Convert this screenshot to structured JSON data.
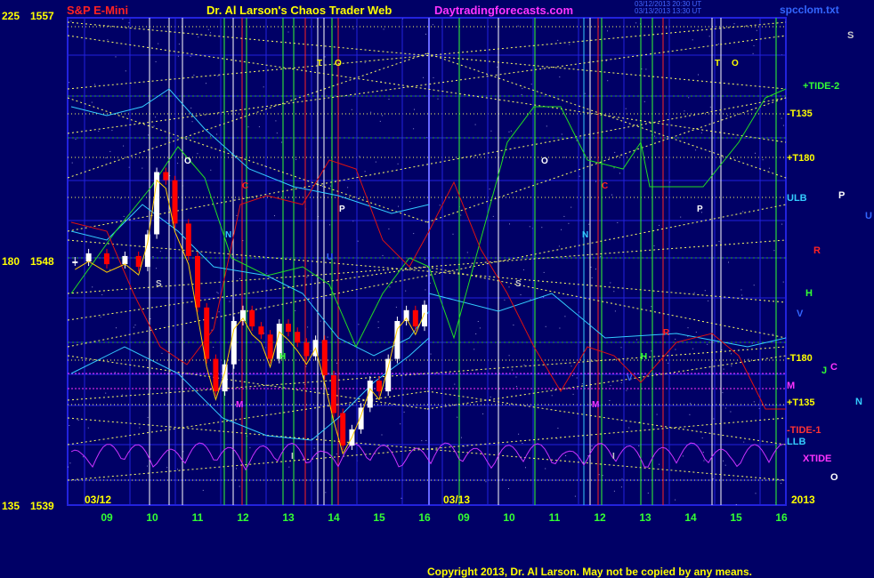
{
  "header": {
    "instrument": "S&P E-Mini",
    "title": "Dr. Al Larson's Chaos Trader Web",
    "site": "Daytradingforecasts.com",
    "file": "spcclom.txt",
    "stamp_line1": "03/12/2013 20:30 UT",
    "stamp_line2": "03/13/2013 13:30 UT"
  },
  "copyright": "Copyright 2013, Dr. Al Larson. May not be copied by any means.",
  "colors": {
    "background": "#000066",
    "price_up": "#ffffff",
    "price_down": "#ff0000",
    "grid": "#2222dd",
    "yellow_lines": "#ffff66",
    "green": "#22dd22",
    "red": "#dd1111",
    "cyan": "#33ccff",
    "magenta": "#cc33ff"
  },
  "chart_data": {
    "type": "line",
    "title": "S&P E-Mini",
    "y_axis": {
      "labels": [
        {
          "left": "225",
          "right": "1557"
        },
        {
          "left": "180",
          "right": "1548"
        },
        {
          "left": "135",
          "right": "1539"
        }
      ],
      "range": [
        1539,
        1557
      ]
    },
    "x_axis": {
      "sessions": [
        "03/12",
        "03/13"
      ],
      "year": "2013",
      "hours": [
        "09",
        "10",
        "11",
        "12",
        "13",
        "14",
        "15",
        "16",
        "09",
        "10",
        "11",
        "12",
        "13",
        "14",
        "15",
        "16"
      ]
    },
    "right_labels": [
      {
        "text": "+TIDE-2",
        "color": "#33ff33"
      },
      {
        "text": "-T135",
        "color": "#ffff00"
      },
      {
        "text": "+T180",
        "color": "#ffff00"
      },
      {
        "text": "ULB",
        "color": "#33ccff"
      },
      {
        "text": "-T180",
        "color": "#ffff00"
      },
      {
        "text": "M",
        "color": "#ff33ff"
      },
      {
        "text": "+T135",
        "color": "#ffff00"
      },
      {
        "text": "-TIDE-1",
        "color": "#ff3333"
      },
      {
        "text": "LLB",
        "color": "#33ccff"
      },
      {
        "text": "XTIDE",
        "color": "#ff33ff"
      }
    ],
    "planet_letters": [
      {
        "text": "S",
        "color": "#cccccc"
      },
      {
        "text": "P",
        "color": "#ffffff"
      },
      {
        "text": "U",
        "color": "#3366ff"
      },
      {
        "text": "R",
        "color": "#ff2222"
      },
      {
        "text": "H",
        "color": "#33ff33"
      },
      {
        "text": "V",
        "color": "#3366ff"
      },
      {
        "text": "J",
        "color": "#33ff33"
      },
      {
        "text": "C",
        "color": "#ff33ff"
      },
      {
        "text": "N",
        "color": "#33ccff"
      },
      {
        "text": "O",
        "color": "#ffffff"
      }
    ],
    "chart_markers": [
      {
        "text": "T",
        "color": "#ffff00"
      },
      {
        "text": "O",
        "color": "#ffff00"
      },
      {
        "text": "T",
        "color": "#ffff00"
      },
      {
        "text": "O",
        "color": "#ffff00"
      },
      {
        "text": "O",
        "color": "#ffffff"
      },
      {
        "text": "O",
        "color": "#ffffff"
      },
      {
        "text": "C",
        "color": "#ff2222"
      },
      {
        "text": "C",
        "color": "#ff2222"
      },
      {
        "text": "P",
        "color": "#ffffff"
      },
      {
        "text": "P",
        "color": "#ffffff"
      },
      {
        "text": "N",
        "color": "#33ccff"
      },
      {
        "text": "N",
        "color": "#33ccff"
      },
      {
        "text": "S",
        "color": "#cccccc"
      },
      {
        "text": "S",
        "color": "#cccccc"
      },
      {
        "text": "U",
        "color": "#3366ff"
      },
      {
        "text": "H",
        "color": "#33ff33"
      },
      {
        "text": "H",
        "color": "#33ff33"
      },
      {
        "text": "R",
        "color": "#ff2222"
      },
      {
        "text": "M",
        "color": "#ff33ff"
      },
      {
        "text": "M",
        "color": "#ff33ff"
      },
      {
        "text": "V",
        "color": "#3366ff"
      },
      {
        "text": "I",
        "color": "#cccccc"
      },
      {
        "text": "I",
        "color": "#cccccc"
      }
    ],
    "series": [
      {
        "name": "Price",
        "x": [
          8.3,
          8.6,
          9.0,
          9.4,
          9.7,
          9.9,
          10.1,
          10.3,
          10.5,
          10.8,
          11.0,
          11.2,
          11.4,
          11.6,
          11.8,
          12.0,
          12.2,
          12.4,
          12.6,
          12.8,
          13.0,
          13.2,
          13.4,
          13.6,
          13.8,
          14.0,
          14.2,
          14.4,
          14.6,
          14.8,
          15.0,
          15.2,
          15.4,
          15.6,
          15.8,
          16.0
        ],
        "y": [
          1548.0,
          1548.3,
          1547.9,
          1548.2,
          1547.8,
          1549.0,
          1551.3,
          1551.0,
          1549.4,
          1548.2,
          1546.3,
          1544.4,
          1543.2,
          1544.2,
          1545.8,
          1546.2,
          1545.6,
          1545.3,
          1544.4,
          1545.7,
          1545.4,
          1545.0,
          1544.5,
          1545.1,
          1543.8,
          1542.4,
          1541.2,
          1541.8,
          1542.6,
          1543.6,
          1543.2,
          1544.4,
          1545.8,
          1546.2,
          1545.6,
          1546.4
        ]
      }
    ]
  }
}
